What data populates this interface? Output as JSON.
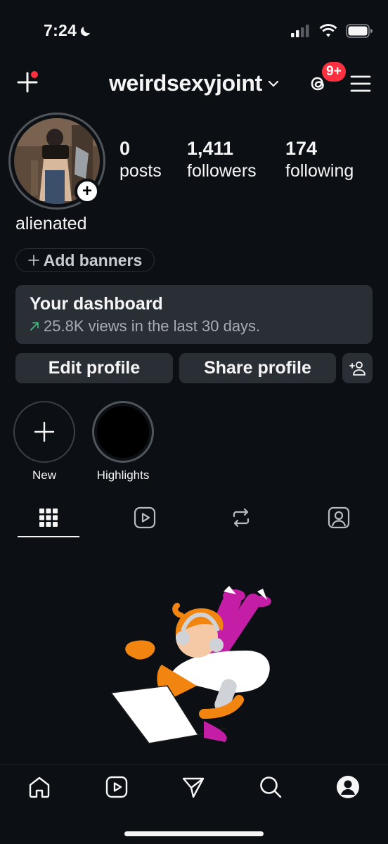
{
  "status_bar": {
    "time": "7:24"
  },
  "header": {
    "username": "weirdsexyjoint",
    "threads_badge": "9+",
    "colors": {
      "badge": "#ff3040",
      "dot": "#ff3040"
    }
  },
  "profile": {
    "stats": [
      {
        "value": "0",
        "label": "posts"
      },
      {
        "value": "1,411",
        "label": "followers"
      },
      {
        "value": "174",
        "label": "following"
      }
    ],
    "name": "alienated",
    "banner_button": "Add banners"
  },
  "dashboard": {
    "title": "Your dashboard",
    "subtitle": "25.8K views in the last 30 days."
  },
  "actions": {
    "edit_profile": "Edit profile",
    "share_profile": "Share profile"
  },
  "highlights": [
    {
      "label": "New"
    },
    {
      "label": "Highlights"
    }
  ],
  "tabs": [
    "grid-icon",
    "reels-icon",
    "reposts-icon",
    "tagged-icon"
  ],
  "bottom_nav": [
    "home-icon",
    "reels-icon",
    "direct-icon",
    "search-icon",
    "profile-icon"
  ],
  "colors": {
    "background": "#0c1014",
    "card": "#2a2f36",
    "accent_green": "#3cc37b"
  }
}
